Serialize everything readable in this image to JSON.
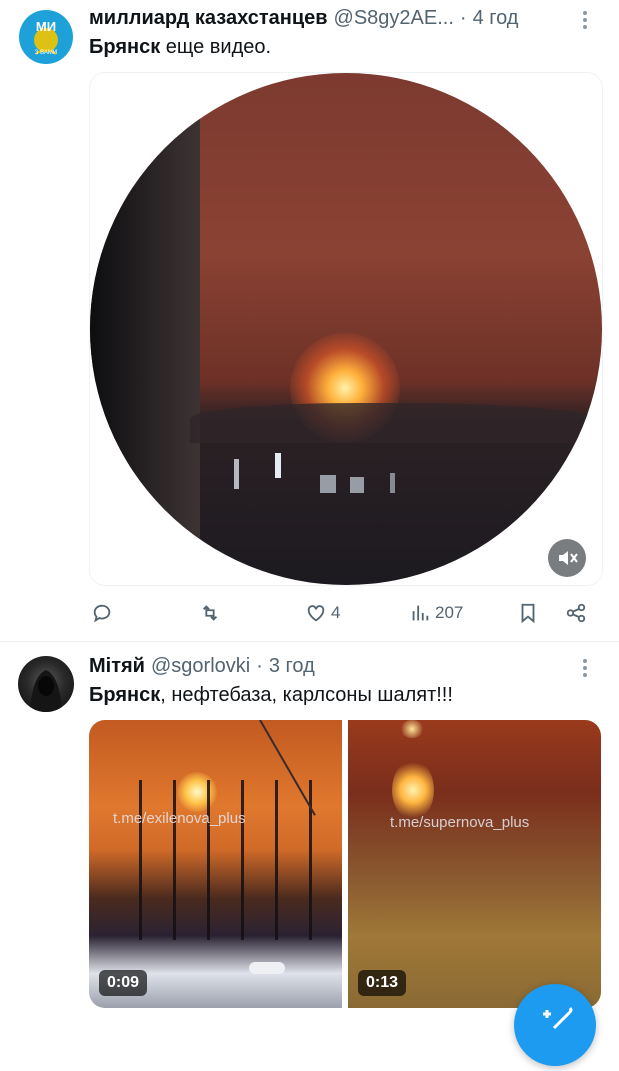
{
  "tweet1": {
    "display_name": "миллиард казахстанцев",
    "handle": "@S8gy2AE...",
    "separator": "·",
    "time": "4 год",
    "text_bold": "Брянск",
    "text_rest": " еще видео.",
    "avatar_text_top": "МИ",
    "avatar_text_bottom": "З ВАМИ",
    "actions": {
      "likes": "4",
      "views": "207"
    },
    "icons": [
      "reply-icon",
      "retweet-icon",
      "heart-icon",
      "views-icon",
      "bookmark-icon",
      "share-icon",
      "mute-icon"
    ]
  },
  "tweet2": {
    "display_name": "Мітяй",
    "handle": "@sgorlovki",
    "separator": "·",
    "time": "3 год",
    "text_bold": "Брянск",
    "text_rest": ", нефтебаза, карлсоны шалят!!!",
    "videos": [
      {
        "duration": "0:09",
        "watermark": "t.me/exilenova_plus"
      },
      {
        "duration": "0:13",
        "watermark": "t.me/supernova_plus"
      }
    ]
  },
  "colors": {
    "text": "#0f1419",
    "secondary": "#536471",
    "accent": "#1d9bf0"
  }
}
